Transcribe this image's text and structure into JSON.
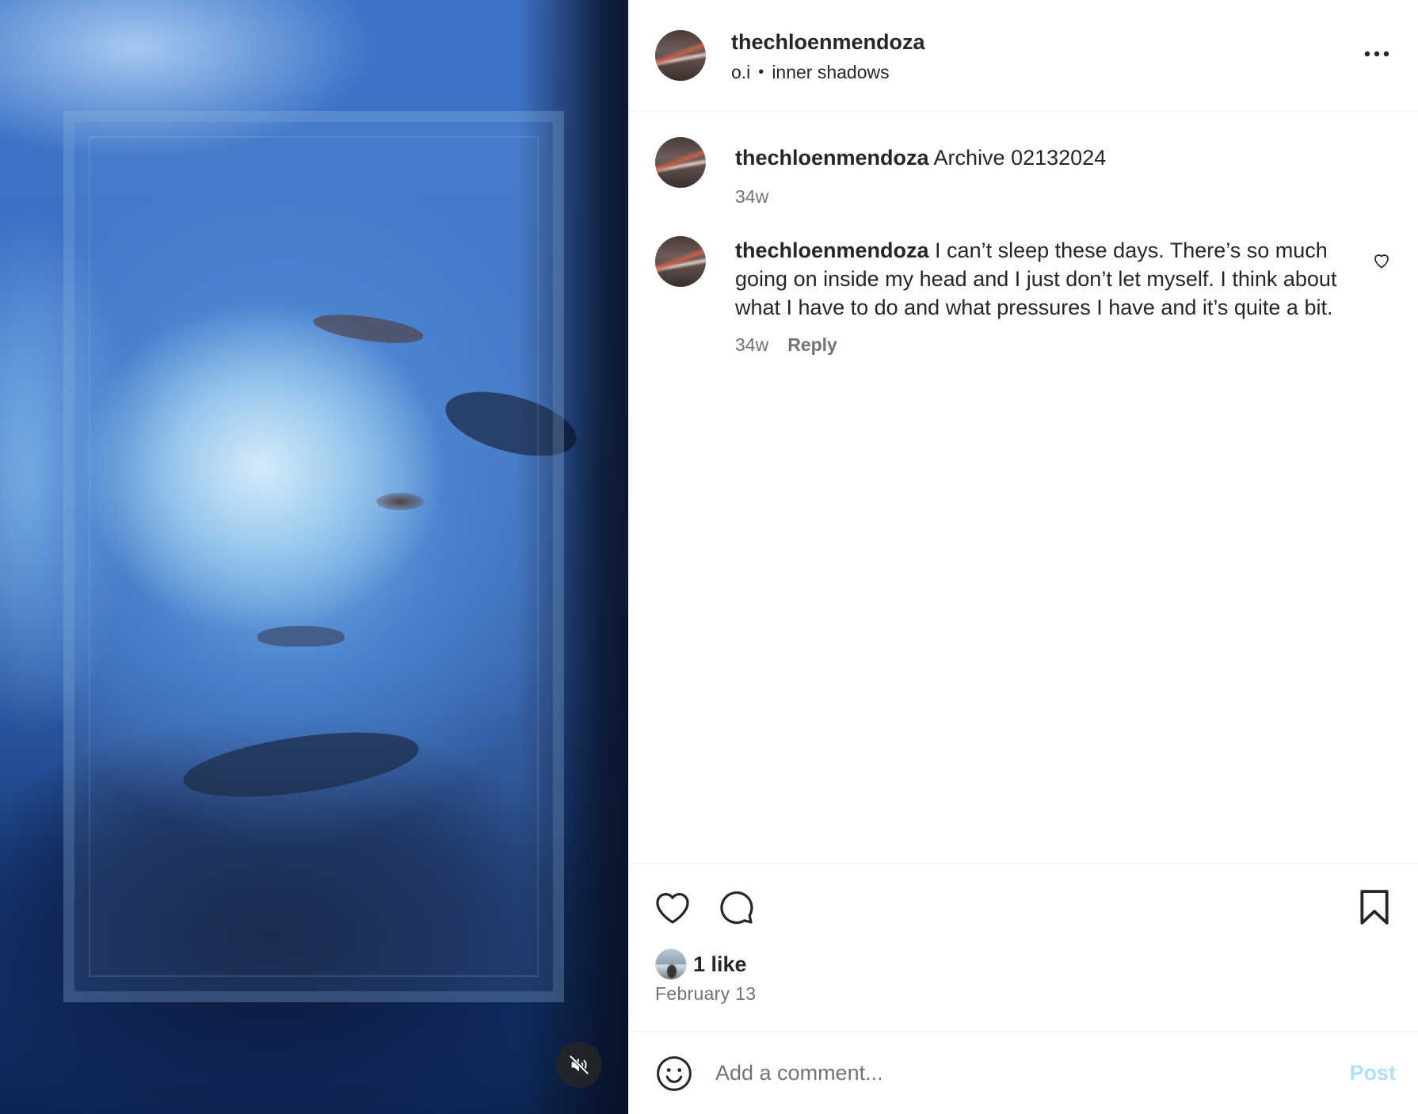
{
  "header": {
    "username": "thechloenmendoza",
    "subtitle_left": "o.i",
    "separator": "•",
    "subtitle_right": "inner shadows"
  },
  "comments": [
    {
      "username": "thechloenmendoza",
      "text": "Archive 02132024",
      "time": "34w"
    },
    {
      "username": "thechloenmendoza",
      "text": "I can’t sleep these days. There’s so much going on inside my head and I just don’t let myself. I think about what I have to do and what pressures I have and it’s quite a bit.",
      "time": "34w",
      "reply_label": "Reply"
    }
  ],
  "likes": {
    "text": "1 like"
  },
  "post_date": "February 13",
  "add_comment": {
    "placeholder": "Add a comment...",
    "post_label": "Post"
  },
  "icons": {
    "mute": "speaker-muted-icon",
    "more": "more-horizontal-icon",
    "like": "heart-icon",
    "comment": "comment-bubble-icon",
    "save": "bookmark-icon",
    "emoji": "smiley-face-icon"
  },
  "colors": {
    "text_primary": "#262626",
    "text_secondary": "#737373",
    "divider": "#efefef",
    "post_button_disabled": "#b2dffc"
  }
}
